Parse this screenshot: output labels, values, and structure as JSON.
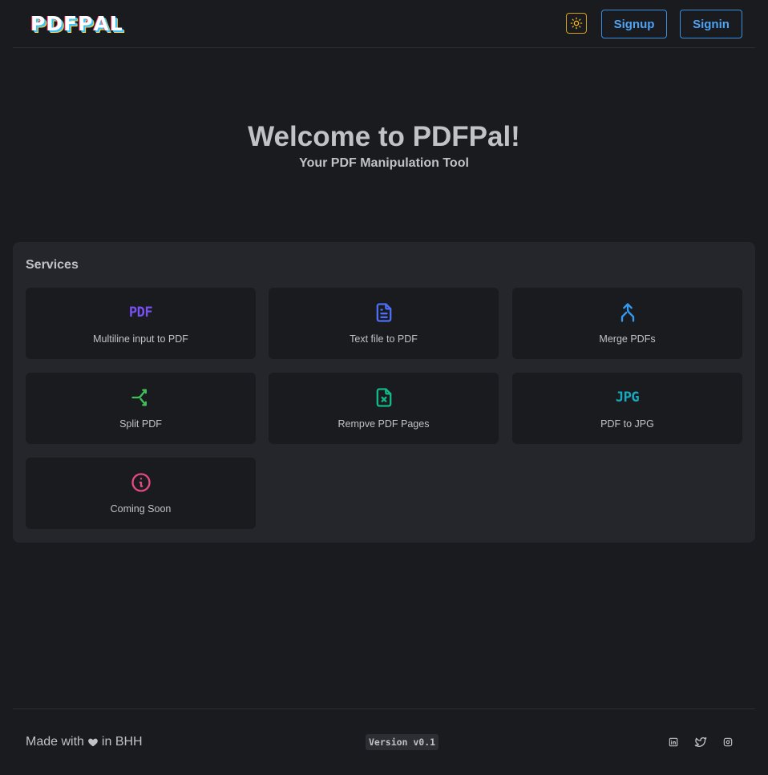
{
  "header": {
    "logo_letters": [
      "P",
      "D",
      "F",
      "P",
      "A",
      "L"
    ],
    "theme_toggle_icon": "sun-icon",
    "signup_label": "Signup",
    "signin_label": "Signin"
  },
  "hero": {
    "title": "Welcome to PDFPal!",
    "subtitle": "Your PDF Manipulation Tool"
  },
  "services": {
    "title": "Services",
    "items": [
      {
        "label": "Multiline input to PDF",
        "icon": "pdf-text-icon",
        "icon_text": "PDF",
        "color": "#7950f2"
      },
      {
        "label": "Text file to PDF",
        "icon": "file-text-icon",
        "color": "#4c6ef5"
      },
      {
        "label": "Merge PDFs",
        "icon": "merge-arrow-icon",
        "color": "#339af0"
      },
      {
        "label": "Split PDF",
        "icon": "split-arrow-icon",
        "color": "#40c057"
      },
      {
        "label": "Rempve PDF Pages",
        "icon": "file-remove-icon",
        "color": "#12b886"
      },
      {
        "label": "PDF to JPG",
        "icon": "jpg-text-icon",
        "icon_text": "JPG",
        "color": "#15aabf"
      },
      {
        "label": "Coming Soon",
        "icon": "info-circle-icon",
        "color": "#e64980"
      }
    ]
  },
  "footer": {
    "made_with_prefix": "Made with",
    "made_with_suffix": "in BHH",
    "version": "Version v0.1",
    "social": [
      "linkedin-icon",
      "twitter-icon",
      "instagram-icon"
    ]
  },
  "colors": {
    "background": "#1a1b1f",
    "panel": "#25262b",
    "accent_blue": "#4da3f5",
    "theme_toggle": "#d4a216"
  }
}
